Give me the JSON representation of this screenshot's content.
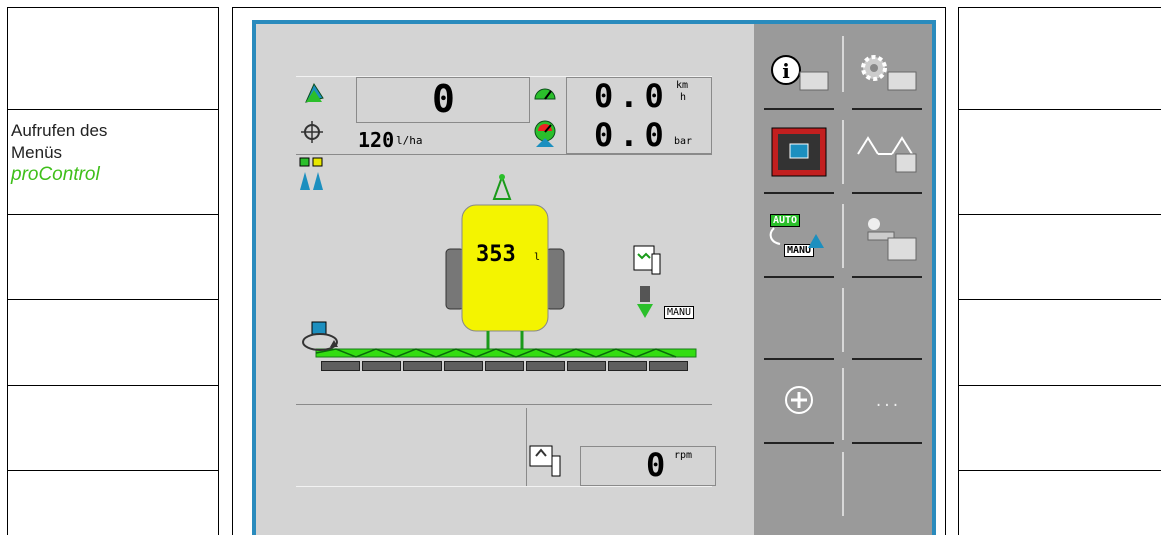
{
  "annotation": {
    "line1": "Aufrufen des",
    "line2": "Menüs",
    "emphasis": "proControl"
  },
  "readouts": {
    "area_value": "0",
    "rate_value": "120",
    "rate_unit": "l/ha",
    "speed_value": "0.0",
    "speed_unit_top": "km",
    "speed_unit_bottom": "h",
    "pressure_value": "0.0",
    "pressure_unit": "bar",
    "tank_value": "353",
    "tank_unit": "l",
    "rpm_value": "0",
    "rpm_unit": "rpm",
    "manu_label": "MANU"
  },
  "softkeys": {
    "auto_label": "AUTO",
    "manu_label": "MANU",
    "more_label": "..."
  },
  "colors": {
    "screen_border": "#2a8bbd",
    "display_bg": "#d4d4d4",
    "softkey_bg": "#9a9a9a",
    "tank_yellow": "#f4f400",
    "boom_green": "#33dd11",
    "emphasis_green": "#3fbf1a"
  }
}
